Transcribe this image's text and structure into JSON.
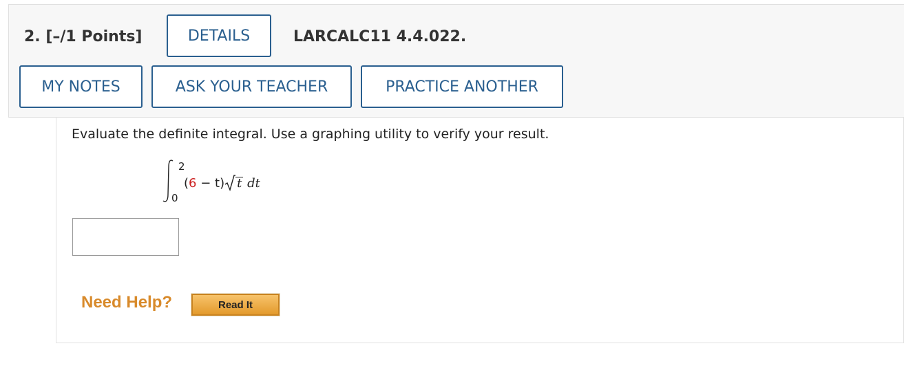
{
  "question": {
    "number_label": "2. [–/1 Points]",
    "code": "LARCALC11 4.4.022."
  },
  "buttons": {
    "details": "DETAILS",
    "my_notes": "MY NOTES",
    "ask_teacher": "ASK YOUR TEACHER",
    "practice_another": "PRACTICE ANOTHER"
  },
  "problem": {
    "prompt": "Evaluate the definite integral. Use a graphing utility to verify your result.",
    "integral": {
      "upper_limit": "2",
      "lower_limit": "0",
      "open_paren": "(",
      "coefficient": "6",
      "minus_t": " − t)",
      "sqrt_var": "t",
      "differential": "dt"
    },
    "answer_value": ""
  },
  "help": {
    "label": "Need Help?",
    "read_it": "Read It"
  },
  "colors": {
    "button_accent": "#2a5f8f",
    "highlight_number": "#cc2222",
    "help_orange": "#d88a2b"
  }
}
